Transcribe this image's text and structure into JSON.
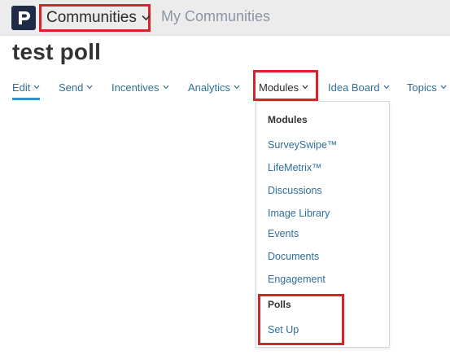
{
  "topbar": {
    "communities_label": "Communities",
    "my_communities_label": "My Communities"
  },
  "page": {
    "title": "test poll"
  },
  "nav": {
    "tabs": [
      {
        "label": "Edit",
        "active": true
      },
      {
        "label": "Send"
      },
      {
        "label": "Incentives"
      },
      {
        "label": "Analytics"
      },
      {
        "label": "Modules",
        "open": true
      },
      {
        "label": "Idea Board"
      },
      {
        "label": "Topics"
      }
    ]
  },
  "dropdown": {
    "modules_heading": "Modules",
    "modules_items": [
      "SurveySwipe™",
      "LifeMetrix™",
      "Discussions",
      "Image Library",
      "Events",
      "Documents",
      "Engagement"
    ],
    "polls_heading": "Polls",
    "polls_items": [
      "Set Up"
    ]
  },
  "colors": {
    "highlight": "#d8232a",
    "link": "#2f6f99",
    "active_underline": "#2b95d6",
    "logo_bg": "#1f2b46"
  },
  "icons": {
    "logo": "p-logo-icon",
    "chevron": "chevron-down-icon"
  }
}
